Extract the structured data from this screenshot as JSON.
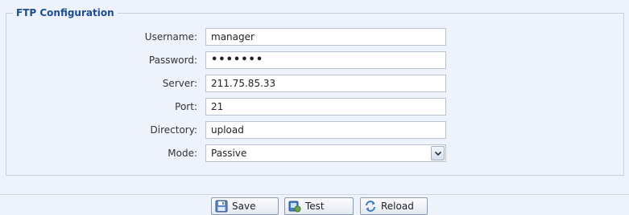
{
  "section": {
    "title": "FTP Configuration"
  },
  "form": {
    "username_label": "Username:",
    "username_value": "manager",
    "password_label": "Password:",
    "password_value": "•••••••",
    "server_label": "Server:",
    "server_value": "211.75.85.33",
    "port_label": "Port:",
    "port_value": "21",
    "directory_label": "Directory:",
    "directory_value": "upload",
    "mode_label": "Mode:",
    "mode_value": "Passive"
  },
  "buttons": {
    "save": "Save",
    "test": "Test",
    "reload": "Reload"
  },
  "icons": {
    "save": "floppy-disk-icon",
    "test": "test-connection-icon",
    "reload": "reload-arrows-icon",
    "dropdown": "chevron-down-icon"
  },
  "colors": {
    "legend": "#1c4d92",
    "background": "#eef2fa"
  }
}
